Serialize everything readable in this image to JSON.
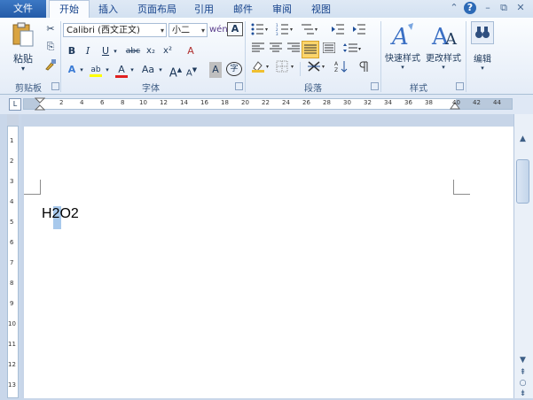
{
  "tabs": {
    "file": "文件",
    "home": "开始",
    "insert": "插入",
    "layout": "页面布局",
    "references": "引用",
    "mailings": "邮件",
    "review": "审阅",
    "view": "视图"
  },
  "window_controls": {
    "help": "?"
  },
  "clipboard": {
    "paste_label": "粘贴",
    "group_label": "剪贴板"
  },
  "font": {
    "font_name": "Calibri (西文正文)",
    "font_size": "小二",
    "bold": "B",
    "italic": "I",
    "underline": "U",
    "strikethrough": "abc",
    "subscript": "x₂",
    "superscript": "x²",
    "clear_format": "A",
    "highlight": "ab",
    "font_color": "A",
    "change_case": "Aa",
    "grow": "A",
    "shrink": "A",
    "char_shading": "A",
    "enclosed_char": "字",
    "group_label": "字体"
  },
  "paragraph": {
    "group_label": "段落"
  },
  "styles": {
    "quick_styles": "快速样式",
    "change_styles": "更改样式",
    "group_label": "样式"
  },
  "editing": {
    "label": "编辑"
  },
  "ruler": {
    "ticks": [
      "L",
      "2",
      "4",
      "6",
      "8",
      "10",
      "12",
      "14",
      "16",
      "18",
      "20",
      "22",
      "24",
      "26",
      "28",
      "30",
      "32",
      "34",
      "36",
      "38",
      "40",
      "42",
      "44"
    ]
  },
  "vruler": {
    "ticks": [
      "1",
      "2",
      "3",
      "4",
      "5",
      "6",
      "7",
      "8",
      "9",
      "10",
      "11",
      "12",
      "13"
    ]
  },
  "document": {
    "text": "H2O2"
  },
  "colors": {
    "accent": "#2b579a",
    "highlight": "#ffff00",
    "font_red": "#e02020"
  }
}
